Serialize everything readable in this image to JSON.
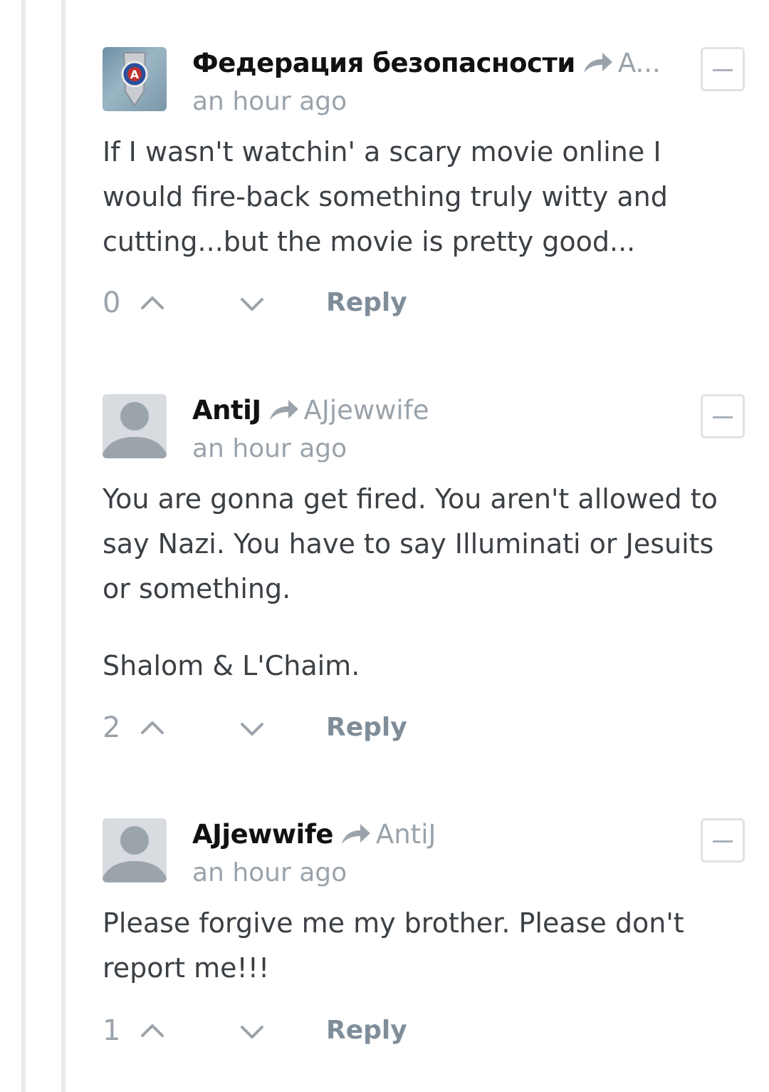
{
  "comments": [
    {
      "author": "Федерация безопасности",
      "reply_to": "A...",
      "timestamp": "an hour ago",
      "avatar": "security-federation-badge-icon",
      "body": [
        "If I wasn't watchin' a scary movie online I would fire-back something truly witty and cutting...but the movie is pretty good..."
      ],
      "votes": "0",
      "reply_label": "Reply"
    },
    {
      "author": "AntiJ",
      "reply_to": "AJjewwife",
      "timestamp": "an hour ago",
      "avatar": "default-user-icon",
      "body": [
        "You are gonna get fired. You aren't allowed to say Nazi. You have to say Illuminati or Jesuits or something.",
        "Shalom & L'Chaim."
      ],
      "votes": "2",
      "reply_label": "Reply"
    },
    {
      "author": "AJjewwife",
      "reply_to": "AntiJ",
      "timestamp": "an hour ago",
      "avatar": "default-user-icon",
      "body": [
        "Please forgive me my brother. Please don't report me!!!"
      ],
      "votes": "1",
      "reply_label": "Reply"
    }
  ],
  "colors": {
    "author": "#111111",
    "muted": "#9aa3ab",
    "reply_link": "#7f8d99",
    "body": "#3b4045",
    "thread_line": "#e7e9ee"
  }
}
